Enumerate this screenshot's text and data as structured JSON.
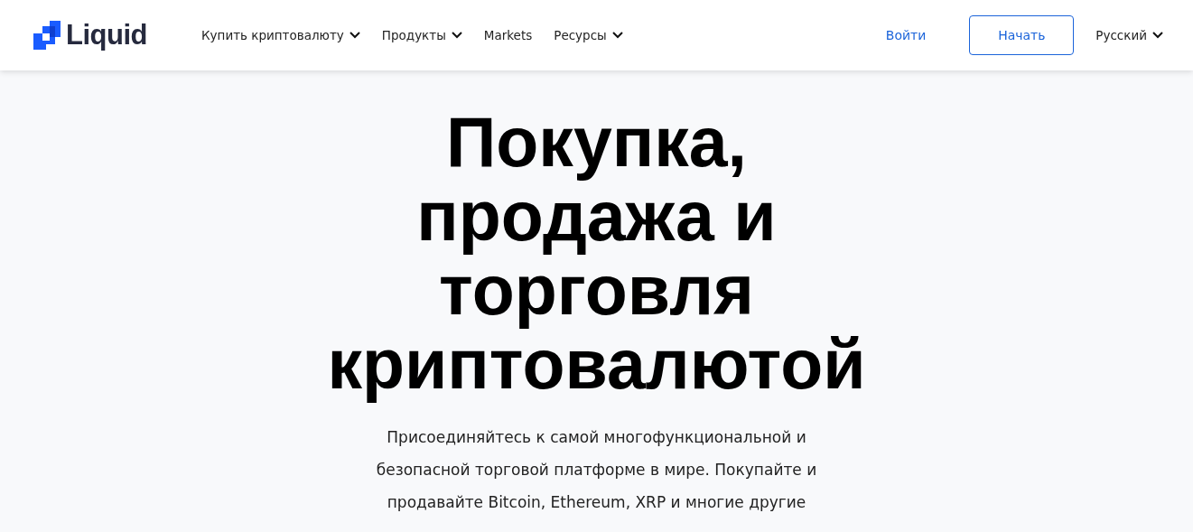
{
  "header": {
    "logo": "Liquid",
    "nav": [
      {
        "label": "Купить криптовалюту",
        "has_menu": true
      },
      {
        "label": "Продукты",
        "has_menu": true
      },
      {
        "label": "Markets",
        "has_menu": false
      },
      {
        "label": "Ресурсы",
        "has_menu": true
      }
    ],
    "login": "Войти",
    "start": "Начать",
    "language": {
      "label": "Русский",
      "has_menu": true
    }
  },
  "hero": {
    "headline_lines": [
      "Покупка,",
      "продажа и",
      "торговля",
      "криптовалютой"
    ],
    "subtitle_lines": [
      "Присоединяйтесь к самой многофункциональной и",
      "безопасной торговой платформе в мире. Покупайте и",
      "продавайте Bitcoin, Ethereum, XRP и многие другие"
    ]
  }
}
